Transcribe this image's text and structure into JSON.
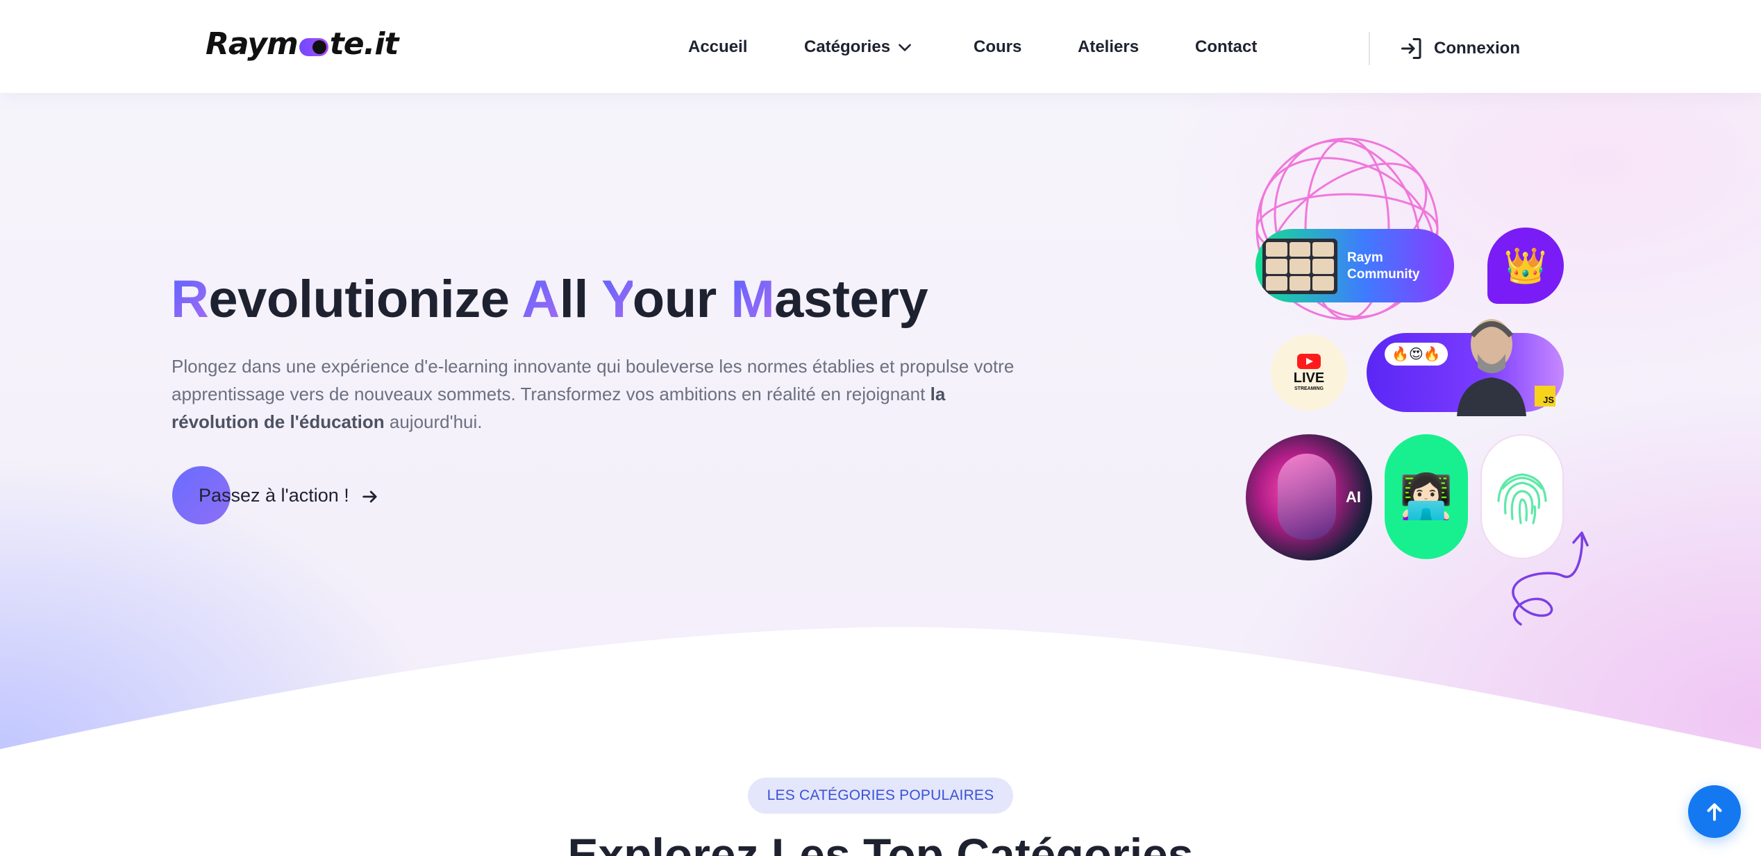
{
  "header": {
    "logo": {
      "part1": "Raym",
      "part2": "te.it"
    },
    "nav": [
      {
        "label": "Accueil"
      },
      {
        "label": "Catégories"
      },
      {
        "label": "Cours"
      },
      {
        "label": "Ateliers"
      },
      {
        "label": "Contact"
      }
    ],
    "login_label": "Connexion"
  },
  "hero": {
    "title_words": [
      {
        "cap": "R",
        "rest": "evolutionize"
      },
      {
        "cap": "A",
        "rest": "ll"
      },
      {
        "cap": "Y",
        "rest": "our"
      },
      {
        "cap": "M",
        "rest": "astery"
      }
    ],
    "description": "Plongez dans une expérience d'e-learning innovante qui bouleverse les normes établies et propulse votre apprentissage vers de nouveaux sommets. Transformez vos ambitions en réalité en rejoignant",
    "description_bold": "la révolution de l'éducation",
    "description_end": "aujourd'hui.",
    "cta_label": "Passez à l'action !"
  },
  "collage": {
    "community_line1": "Raym",
    "community_line2": "Community",
    "live_text": "LIVE",
    "streaming_text": "STREAMING",
    "js_text": "JS",
    "ai_text": "AI"
  },
  "section": {
    "badge": "LES CATÉGORIES POPULAIRES",
    "title": "Explorez Les Top Catégories"
  },
  "icons": {
    "login": "login-arrow-icon",
    "dropdown": "chevron-down-icon",
    "cta_arrow": "arrow-right-icon",
    "scroll_top": "arrow-up-icon"
  },
  "colors": {
    "accent_blue": "#1479f0",
    "gradient_start": "#5b63ff",
    "gradient_end": "#a86bf2",
    "badge_bg": "#e4e6fb",
    "badge_text": "#3a52d6"
  }
}
